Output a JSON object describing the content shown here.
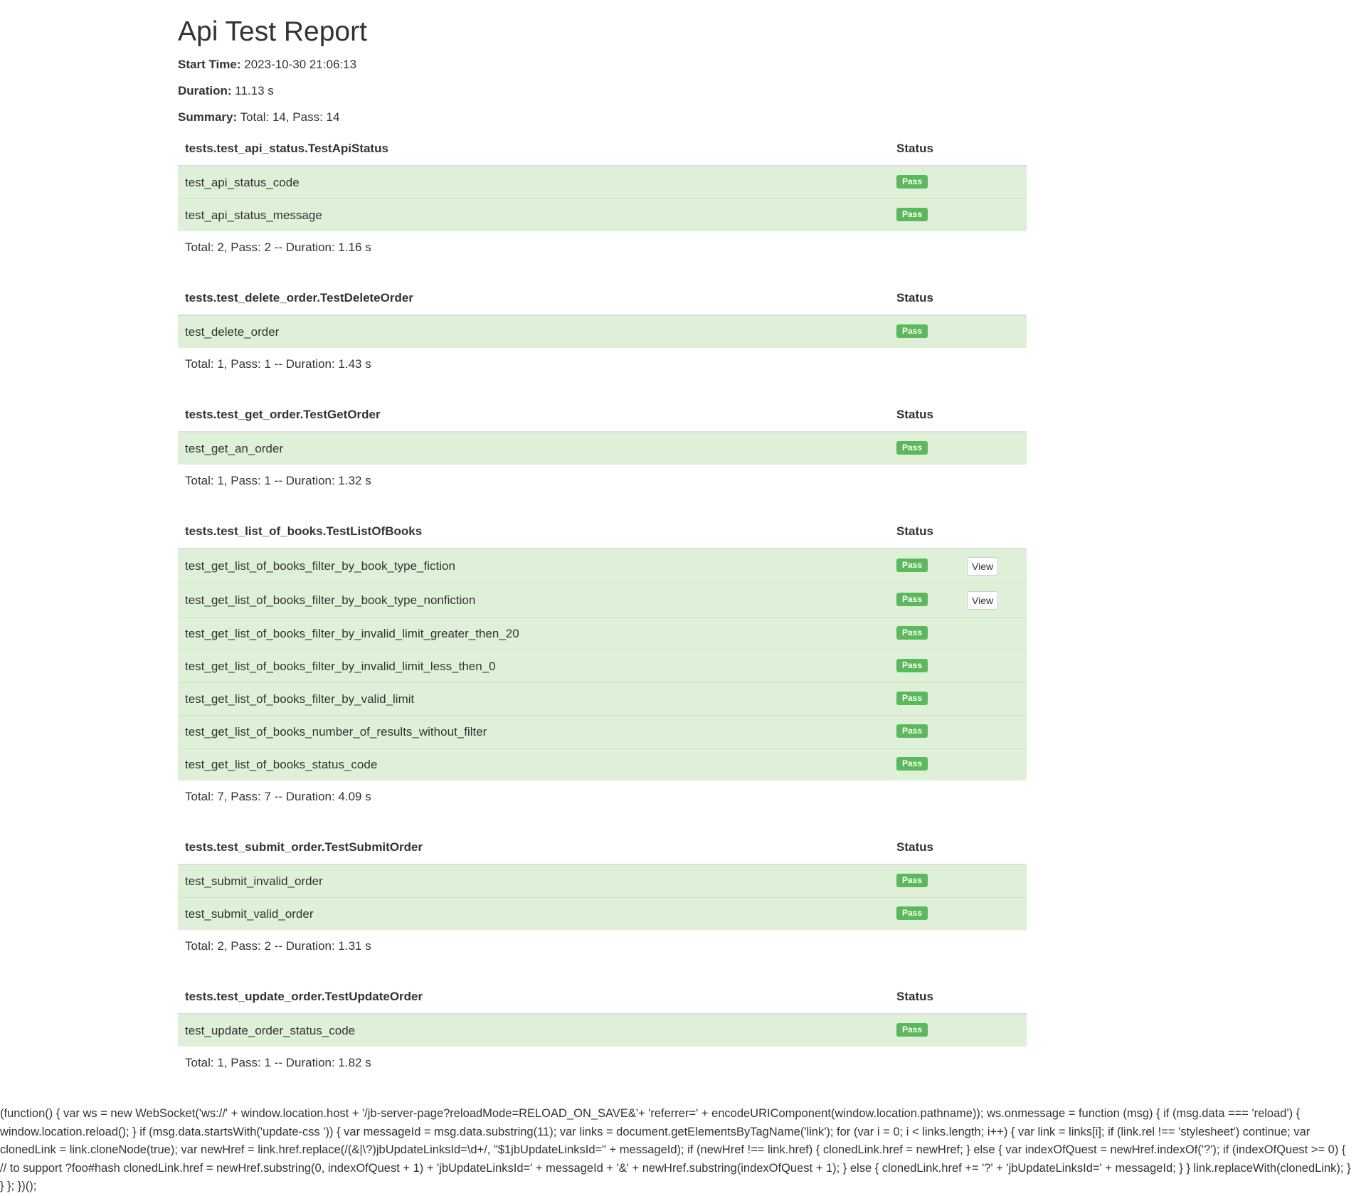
{
  "report": {
    "title": "Api Test Report",
    "start_time_label": "Start Time:",
    "start_time": "2023-10-30 21:06:13",
    "duration_label": "Duration:",
    "duration": "11.13 s",
    "summary_label": "Summary:",
    "summary": "Total: 14, Pass: 14"
  },
  "status_header": "Status",
  "suites": [
    {
      "name": "tests.test_api_status.TestApiStatus",
      "cases": [
        {
          "name": "test_api_status_code",
          "status": "Pass"
        },
        {
          "name": "test_api_status_message",
          "status": "Pass"
        }
      ],
      "summary": "Total: 2, Pass: 2 -- Duration: 1.16 s"
    },
    {
      "name": "tests.test_delete_order.TestDeleteOrder",
      "cases": [
        {
          "name": "test_delete_order",
          "status": "Pass"
        }
      ],
      "summary": "Total: 1, Pass: 1 -- Duration: 1.43 s"
    },
    {
      "name": "tests.test_get_order.TestGetOrder",
      "cases": [
        {
          "name": "test_get_an_order",
          "status": "Pass"
        }
      ],
      "summary": "Total: 1, Pass: 1 -- Duration: 1.32 s"
    },
    {
      "name": "tests.test_list_of_books.TestListOfBooks",
      "cases": [
        {
          "name": "test_get_list_of_books_filter_by_book_type_fiction",
          "status": "Pass",
          "action": "View"
        },
        {
          "name": "test_get_list_of_books_filter_by_book_type_nonfiction",
          "status": "Pass",
          "action": "View"
        },
        {
          "name": "test_get_list_of_books_filter_by_invalid_limit_greater_then_20",
          "status": "Pass"
        },
        {
          "name": "test_get_list_of_books_filter_by_invalid_limit_less_then_0",
          "status": "Pass"
        },
        {
          "name": "test_get_list_of_books_filter_by_valid_limit",
          "status": "Pass"
        },
        {
          "name": "test_get_list_of_books_number_of_results_without_filter",
          "status": "Pass"
        },
        {
          "name": "test_get_list_of_books_status_code",
          "status": "Pass"
        }
      ],
      "summary": "Total: 7, Pass: 7 -- Duration: 4.09 s"
    },
    {
      "name": "tests.test_submit_order.TestSubmitOrder",
      "cases": [
        {
          "name": "test_submit_invalid_order",
          "status": "Pass"
        },
        {
          "name": "test_submit_valid_order",
          "status": "Pass"
        }
      ],
      "summary": "Total: 2, Pass: 2 -- Duration: 1.31 s"
    },
    {
      "name": "tests.test_update_order.TestUpdateOrder",
      "cases": [
        {
          "name": "test_update_order_status_code",
          "status": "Pass"
        }
      ],
      "summary": "Total: 1, Pass: 1 -- Duration: 1.82 s"
    }
  ],
  "colors": {
    "pass_badge": "#5cb85c",
    "pass_row": "#dff0d8"
  },
  "script_text": "(function() { var ws = new WebSocket('ws://' + window.location.host + '/jb-server-page?reloadMode=RELOAD_ON_SAVE&'+ 'referrer=' + encodeURIComponent(window.location.pathname)); ws.onmessage = function (msg) { if (msg.data === 'reload') { window.location.reload(); } if (msg.data.startsWith('update-css ')) { var messageId = msg.data.substring(11); var links = document.getElementsByTagName('link'); for (var i = 0; i < links.length; i++) { var link = links[i]; if (link.rel !== 'stylesheet') continue; var clonedLink = link.cloneNode(true); var newHref = link.href.replace(/(&|\\?)jbUpdateLinksId=\\d+/, \"$1jbUpdateLinksId=\" + messageId); if (newHref !== link.href) { clonedLink.href = newHref; } else { var indexOfQuest = newHref.indexOf('?'); if (indexOfQuest >= 0) { // to support ?foo#hash clonedLink.href = newHref.substring(0, indexOfQuest + 1) + 'jbUpdateLinksId=' + messageId + '&' + newHref.substring(indexOfQuest + 1); } else { clonedLink.href += '?' + 'jbUpdateLinksId=' + messageId; } } link.replaceWith(clonedLink); } } }; })();"
}
